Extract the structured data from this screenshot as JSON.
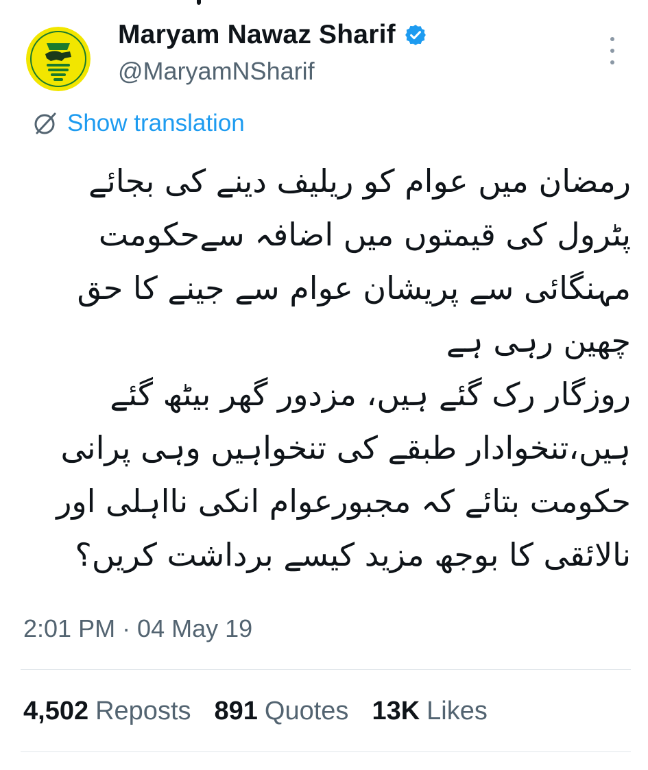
{
  "tweet": {
    "author": {
      "display_name": "Maryam Nawaz Sharif",
      "handle": "@MaryamNSharif",
      "verified": true,
      "avatar_icon": "pmln-party-logo-icon",
      "avatar_colors": {
        "background": "#f2e600",
        "ring": "#1a7a2e"
      }
    },
    "translate_label": "Show translation",
    "text_lines": [
      "رمضان میں عوام کو ریلیف دینے کی بجائے",
      "پٹرول  کی قیمتوں میں اضافہ سےحکومت",
      "مہنگائی سے پریشان عوام سے جینے کا حق",
      "چھین رہی ہے",
      "روزگار رک گئے ہیں، مزدور گھر بیٹھ گئے",
      "ہیں،تنخوادار طبقے کی تنخواہیں وہی پرانی",
      "حکومت بتائے کہ  مجبورعوام انکی نااہلی اور",
      "نالائقی کا بوجھ مزید کیسے برداشت کریں؟"
    ],
    "timestamp": "2:01 PM · 04 May 19",
    "stats": {
      "reposts": {
        "value": "4,502",
        "label": "Reposts"
      },
      "quotes": {
        "value": "891",
        "label": "Quotes"
      },
      "likes": {
        "value": "13K",
        "label": "Likes"
      }
    }
  },
  "colors": {
    "accent": "#1d9bf0",
    "text_primary": "#0f1419",
    "text_secondary": "#536471",
    "divider": "#e1e6ea"
  }
}
